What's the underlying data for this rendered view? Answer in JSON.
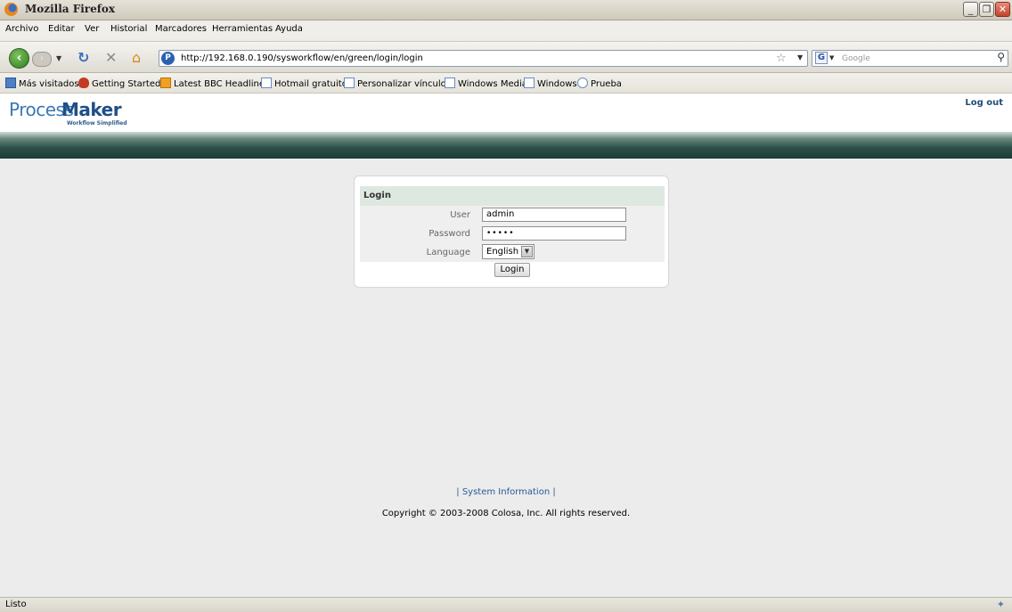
{
  "window": {
    "title": "Mozilla Firefox"
  },
  "menu": [
    "Archivo",
    "Editar",
    "Ver",
    "Historial",
    "Marcadores",
    "Herramientas",
    "Ayuda"
  ],
  "nav": {
    "url": "http://192.168.0.190/sysworkflow/en/green/login/login",
    "search_placeholder": "Google"
  },
  "bookmarks": [
    "Más visitados",
    "Getting Started",
    "Latest BBC Headlines",
    "Hotmail gratuito",
    "Personalizar vínculos",
    "Windows Media",
    "Windows",
    "Prueba"
  ],
  "header": {
    "logo_a": "Process",
    "logo_b": "Maker",
    "tagline": "Workflow Simplified",
    "logout": "Log out"
  },
  "login": {
    "title": "Login",
    "user_label": "User",
    "user_value": "admin",
    "password_label": "Password",
    "password_value": "•••••",
    "language_label": "Language",
    "language_value": "English",
    "button": "Login"
  },
  "footer": {
    "link": "| System Information |",
    "copyright": "Copyright © 2003-2008 Colosa, Inc. All rights reserved."
  },
  "status": {
    "text": "Listo"
  },
  "colors": {
    "brand_dark": "#1e4f87",
    "brand_light": "#3c79b5",
    "header_bar": "#2c4f48",
    "login_title_bg": "#dde8e1"
  }
}
